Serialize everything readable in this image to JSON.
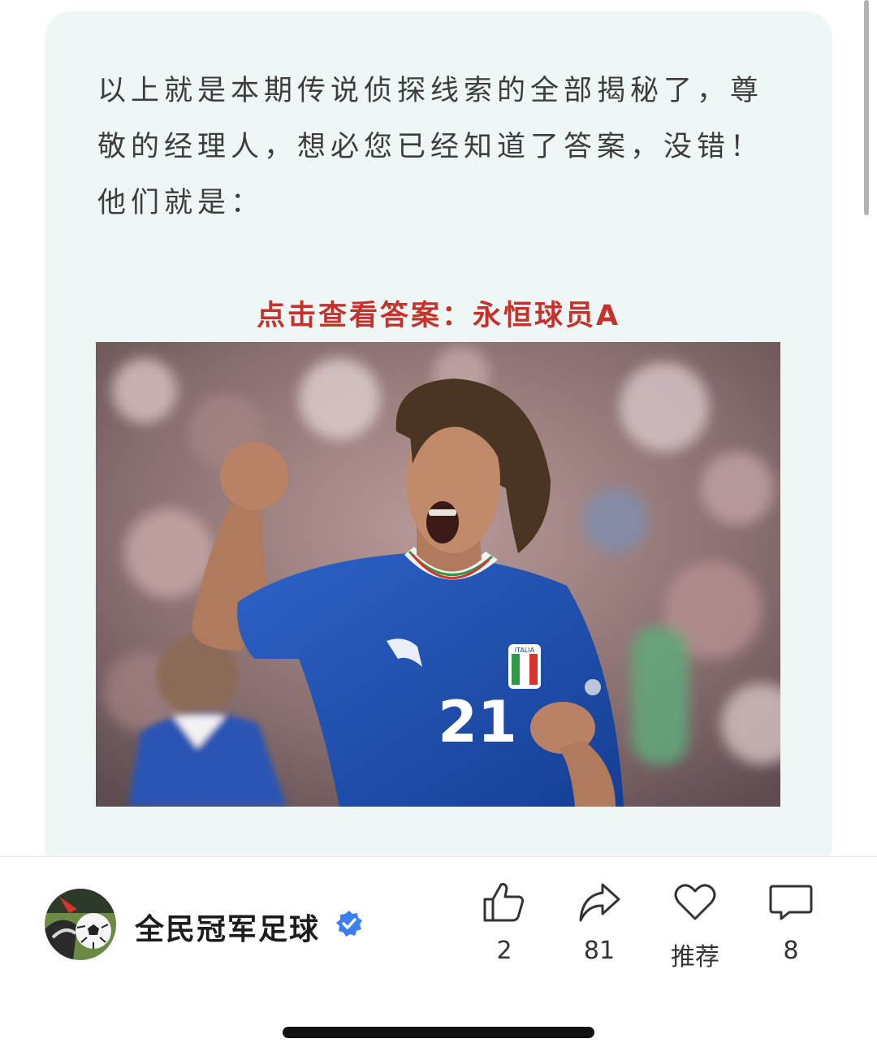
{
  "article": {
    "paragraph": "以上就是本期传说侦探线索的全部揭秘了，尊敬的经理人，想必您已经知道了答案，没错！他们就是：",
    "answer_link": "点击查看答案：永恒球员A"
  },
  "photo": {
    "jersey_number": "21",
    "badge_text": "ITALIA"
  },
  "author": {
    "name": "全民冠军足球",
    "verified_icon": "verified-badge-icon",
    "colors": {
      "verified": "#3b7ff2"
    }
  },
  "actions": {
    "like": {
      "icon": "thumbs-up-icon",
      "count": "2"
    },
    "share": {
      "icon": "share-arrow-icon",
      "count": "81"
    },
    "recommend": {
      "icon": "heart-icon",
      "label": "推荐"
    },
    "comment": {
      "icon": "comment-bubble-icon",
      "count": "8"
    }
  },
  "colors": {
    "card_background": "#eff7f6",
    "answer_link": "#c5322c",
    "body_text": "#3d3d3d",
    "jersey_blue": "#1f4fb0"
  }
}
